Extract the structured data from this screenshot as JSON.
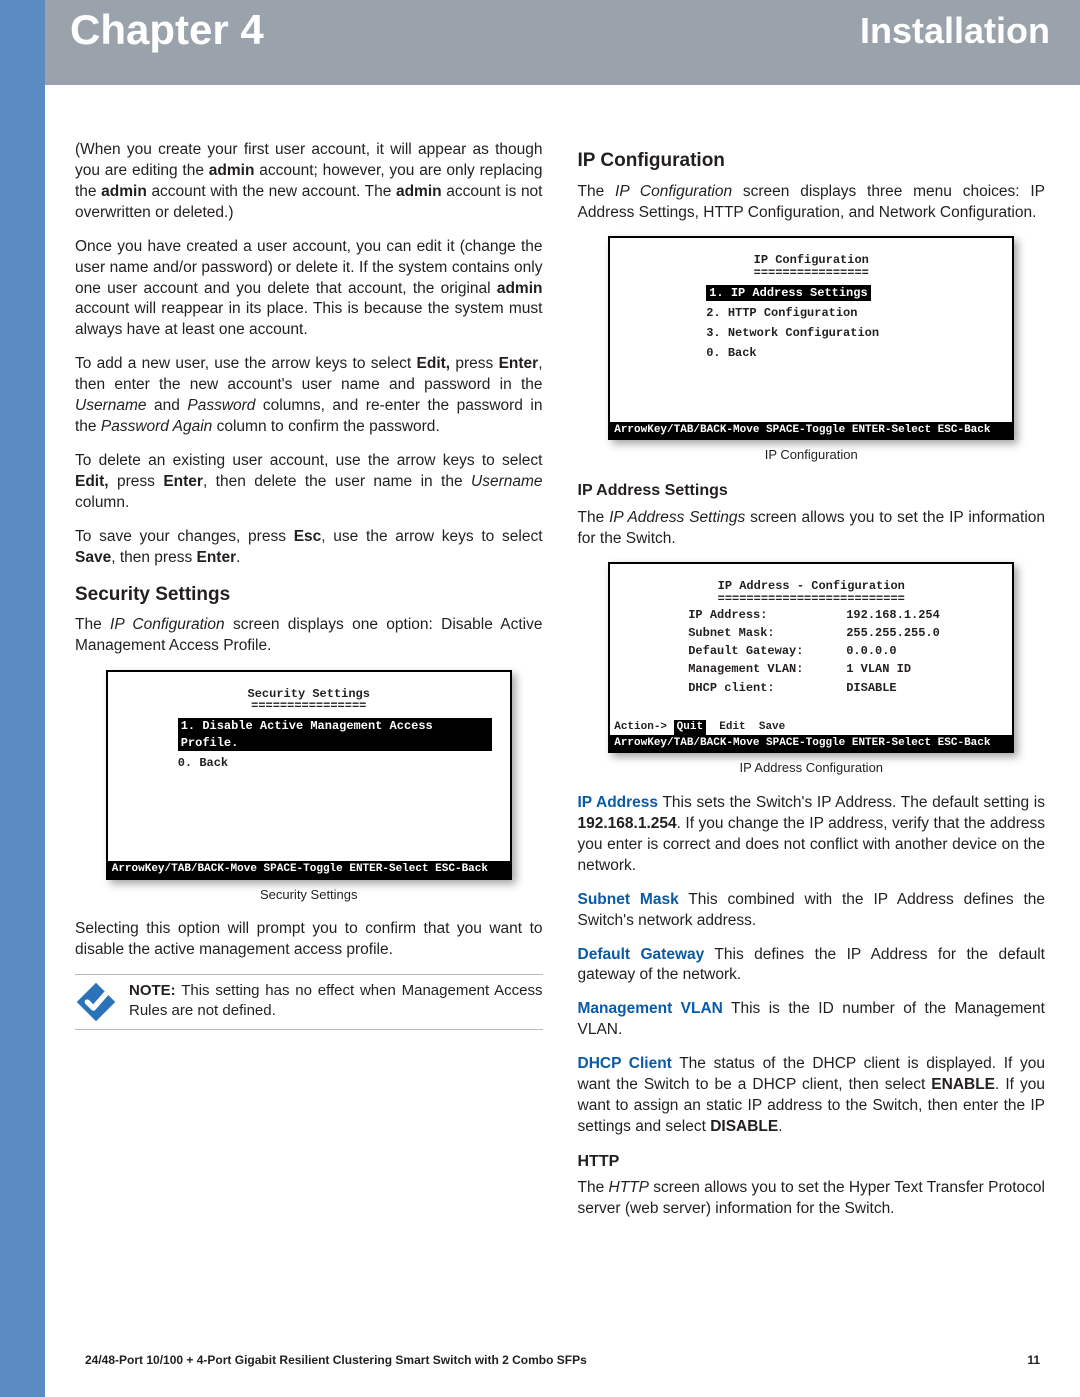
{
  "header": {
    "chapter": "Chapter 4",
    "section": "Installation"
  },
  "left": {
    "p_admin": "(When you create your first user account, it will appear as though you are editing the <b>admin</b> account; however, you are only replacing the <b>admin</b> account with the new account. The <b>admin</b> account is not overwritten or deleted.)",
    "p_editdel": "Once you have created a user account, you can edit it (change the user name and/or password) or delete it. If the system contains only one user account and you delete that account, the original <b>admin</b> account will reappear in its place. This is because the system must always have at least one account.",
    "p_addnew": "To add a new user, use the arrow keys to select <b>Edit,</b> press <b>Enter</b>, then enter the new account's user name and password in the <i>Username</i> and <i>Password</i> columns, and re-enter the password in the <i>Password Again</i> column to confirm the password.",
    "p_deluser": "To delete an existing user account, use the arrow keys to select <b>Edit,</b> press <b>Enter</b>, then delete the user name in the <i>Username</i> column.",
    "p_save": "To save your changes, press <b>Esc</b>, use the arrow keys to select <b>Save</b>, then press <b>Enter</b>.",
    "h_sec": "Security Settings",
    "p_secintro": "The <i>IP Configuration</i> screen displays one option: Disable Active Management Access Profile.",
    "console_sec": {
      "title": "Security Settings",
      "item1": "1. Disable Active Management Access Profile.",
      "item0": "0. Back",
      "bar": "ArrowKey/TAB/BACK-Move  SPACE-Toggle  ENTER-Select  ESC-Back"
    },
    "cap_sec": "Security Settings",
    "p_secsel": "Selecting this option will prompt you to confirm that you want to disable the active management access profile.",
    "note_label": "NOTE:",
    "note_body": " This setting has no effect when Management Access Rules are not defined."
  },
  "right": {
    "h_ipcfg": "IP Configuration",
    "p_ipcfg": "The <i>IP Configuration</i> screen displays three menu choices: IP Address Settings, HTTP Configuration, and Network Configuration.",
    "console_ipcfg": {
      "title": "IP Configuration",
      "item1": "1. IP Address Settings",
      "item2": "2. HTTP Configuration",
      "item3": "3. Network Configuration",
      "item0": "0. Back",
      "bar": "ArrowKey/TAB/BACK-Move  SPACE-Toggle  ENTER-Select  ESC-Back"
    },
    "cap_ipcfg": "IP Configuration",
    "h_ipaddr": "IP Address Settings",
    "p_ipaddr": "The <i>IP Address Settings</i> screen allows you to set the IP information for the Switch.",
    "console_ipaddr": {
      "title": "IP Address - Configuration",
      "rows": [
        {
          "k": "IP Address:",
          "v": "192.168.1.254"
        },
        {
          "k": "Subnet Mask:",
          "v": "255.255.255.0"
        },
        {
          "k": "Default Gateway:",
          "v": "0.0.0.0"
        },
        {
          "k": "Management VLAN:",
          "v": "1    VLAN ID"
        },
        {
          "k": "DHCP client:",
          "v": "DISABLE"
        }
      ],
      "action": "Action-> Quit  Edit  Save",
      "bar": "ArrowKey/TAB/BACK-Move  SPACE-Toggle  ENTER-Select  ESC-Back"
    },
    "cap_ipaddr": "IP Address Configuration",
    "defs": {
      "ip": {
        "t": "IP Address",
        "b": "  This sets the Switch's IP Address. The default setting is <b>192.168.1.254</b>. If you change the IP address, verify that the address you enter is correct and does not conflict with another device on the network."
      },
      "sm": {
        "t": "Subnet Mask",
        "b": "  This combined with the IP Address defines the Switch's network address."
      },
      "gw": {
        "t": "Default Gateway",
        "b": " This defines the IP Address for the default gateway of the network."
      },
      "mv": {
        "t": "Management VLAN",
        "b": " This is the ID number of the Management VLAN."
      },
      "dh": {
        "t": "DHCP Client",
        "b": "  The status of the DHCP client is displayed. If you want the Switch to be a DHCP client, then select <b>ENABLE</b>. If you want to assign an static IP address to the Switch, then enter the IP settings and select <b>DISABLE</b>."
      }
    },
    "h_http": "HTTP",
    "p_http": "The <i>HTTP</i> screen allows you to set the Hyper Text Transfer Protocol server (web server) information for the Switch."
  },
  "footer": {
    "product": "24/48-Port 10/100 + 4-Port Gigabit Resilient Clustering Smart Switch with 2 Combo SFPs",
    "page": "11"
  }
}
